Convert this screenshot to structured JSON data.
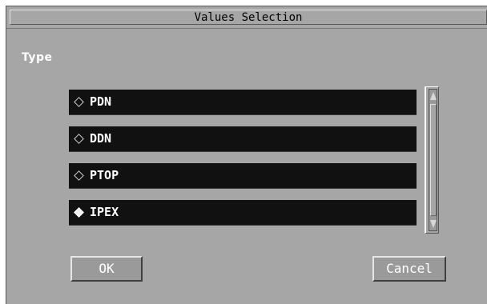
{
  "dialog": {
    "title": "Values Selection",
    "type_label": "Type",
    "options": [
      {
        "label": "PDN",
        "selected": false
      },
      {
        "label": "DDN",
        "selected": false
      },
      {
        "label": "PTOP",
        "selected": false
      },
      {
        "label": "IPEX",
        "selected": true
      }
    ],
    "ok_label": "OK",
    "cancel_label": "Cancel"
  },
  "colors": {
    "window_bg": "#a6a6a6",
    "list_item_bg": "#111111",
    "text_light": "#ffffff"
  },
  "icons": {
    "radio_unselected": "diamond-outline-icon",
    "radio_selected": "diamond-filled-icon",
    "scroll_up": "scroll-up-arrow-icon",
    "scroll_down": "scroll-down-arrow-icon"
  }
}
